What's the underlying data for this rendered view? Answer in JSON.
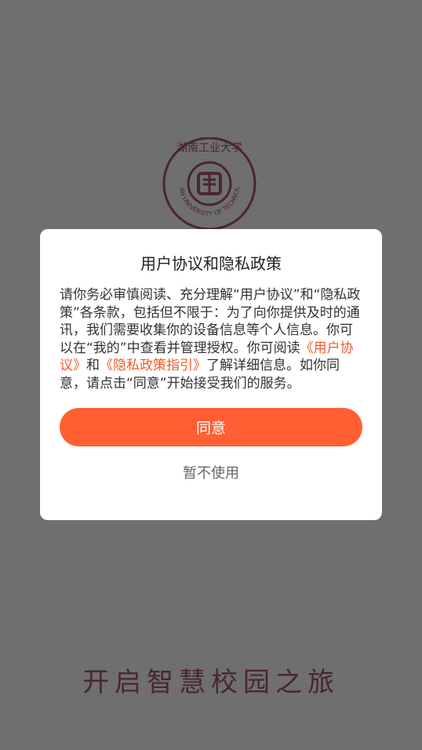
{
  "splash": {
    "slogan": "开启智慧校园之旅",
    "logo": {
      "top_text": "湖南工业大学",
      "ring_text": "HUNAN UNIVERSITY OF TECHNOLOGY",
      "color": "#4a2630"
    }
  },
  "dialog": {
    "title": "用户协议和隐私政策",
    "body_part1": "请你务必审慎阅读、充分理解“用户协议”和“隐私政策”各条款，包括但不限于：为了向你提供及时的通讯，我们需要收集你的设备信息等个人信息。你可以在“我的”中查看并管理授权。你可阅读",
    "link_user_agreement": "《用户协议》",
    "body_and": "和",
    "link_privacy_guide": "《隐私政策指引》",
    "body_part2": "了解详细信息。如你同意，请点击“同意”开始接受我们的服务。",
    "agree_label": "同意",
    "decline_label": "暂不使用",
    "accent_color": "#ff5f33",
    "link_color": "#f05a2b"
  }
}
